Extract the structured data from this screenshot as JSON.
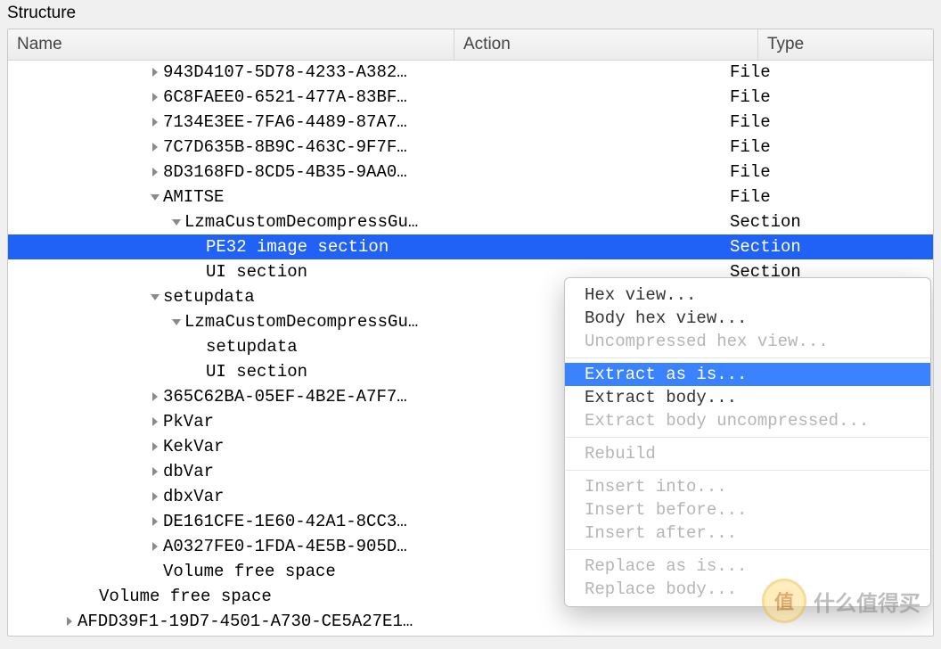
{
  "panel_title": "Structure",
  "columns": {
    "name": "Name",
    "action": "Action",
    "type": "Type"
  },
  "indent_unit": 24,
  "base_indent": 60,
  "rows": [
    {
      "name": "943D4107-5D78-4233-A382…",
      "type": "File",
      "depth": 4,
      "arrow": "right",
      "selected": false
    },
    {
      "name": "6C8FAEE0-6521-477A-83BF…",
      "type": "File",
      "depth": 4,
      "arrow": "right",
      "selected": false
    },
    {
      "name": "7134E3EE-7FA6-4489-87A7…",
      "type": "File",
      "depth": 4,
      "arrow": "right",
      "selected": false
    },
    {
      "name": "7C7D635B-8B9C-463C-9F7F…",
      "type": "File",
      "depth": 4,
      "arrow": "right",
      "selected": false
    },
    {
      "name": "8D3168FD-8CD5-4B35-9AA0…",
      "type": "File",
      "depth": 4,
      "arrow": "right",
      "selected": false
    },
    {
      "name": "AMITSE",
      "type": "File",
      "depth": 4,
      "arrow": "down",
      "selected": false
    },
    {
      "name": "LzmaCustomDecompressGu…",
      "type": "Section",
      "depth": 5,
      "arrow": "down",
      "selected": false
    },
    {
      "name": "PE32 image section",
      "type": "Section",
      "depth": 6,
      "arrow": "none",
      "selected": true
    },
    {
      "name": "UI section",
      "type": "Section",
      "depth": 6,
      "arrow": "none",
      "selected": false
    },
    {
      "name": "setupdata",
      "type": "",
      "depth": 4,
      "arrow": "down",
      "selected": false
    },
    {
      "name": "LzmaCustomDecompressGu…",
      "type": "",
      "depth": 5,
      "arrow": "down",
      "selected": false
    },
    {
      "name": "setupdata",
      "type": "",
      "depth": 6,
      "arrow": "none",
      "selected": false
    },
    {
      "name": "UI section",
      "type": "",
      "depth": 6,
      "arrow": "none",
      "selected": false
    },
    {
      "name": "365C62BA-05EF-4B2E-A7F7…",
      "type": "",
      "depth": 4,
      "arrow": "right",
      "selected": false
    },
    {
      "name": "PkVar",
      "type": "",
      "depth": 4,
      "arrow": "right",
      "selected": false
    },
    {
      "name": "KekVar",
      "type": "",
      "depth": 4,
      "arrow": "right",
      "selected": false
    },
    {
      "name": "dbVar",
      "type": "",
      "depth": 4,
      "arrow": "right",
      "selected": false
    },
    {
      "name": "dbxVar",
      "type": "",
      "depth": 4,
      "arrow": "right",
      "selected": false
    },
    {
      "name": "DE161CFE-1E60-42A1-8CC3…",
      "type": "",
      "depth": 4,
      "arrow": "right",
      "selected": false
    },
    {
      "name": "A0327FE0-1FDA-4E5B-905D…",
      "type": "",
      "depth": 4,
      "arrow": "right",
      "selected": false
    },
    {
      "name": "Volume free space",
      "type": "",
      "depth": 4,
      "arrow": "none",
      "selected": false
    },
    {
      "name": "Volume free space",
      "type": "",
      "depth": 1,
      "arrow": "none",
      "selected": false
    },
    {
      "name": "AFDD39F1-19D7-4501-A730-CE5A27E1…",
      "type": "",
      "depth": 0,
      "arrow": "right",
      "selected": false
    }
  ],
  "context_menu": {
    "groups": [
      [
        {
          "label": "Hex view...",
          "enabled": true,
          "hover": false
        },
        {
          "label": "Body hex view...",
          "enabled": true,
          "hover": false
        },
        {
          "label": "Uncompressed hex view...",
          "enabled": false,
          "hover": false
        }
      ],
      [
        {
          "label": "Extract as is...",
          "enabled": true,
          "hover": true
        },
        {
          "label": "Extract body...",
          "enabled": true,
          "hover": false
        },
        {
          "label": "Extract body uncompressed...",
          "enabled": false,
          "hover": false
        }
      ],
      [
        {
          "label": "Rebuild",
          "enabled": false,
          "hover": false
        }
      ],
      [
        {
          "label": "Insert into...",
          "enabled": false,
          "hover": false
        },
        {
          "label": "Insert before...",
          "enabled": false,
          "hover": false
        },
        {
          "label": "Insert after...",
          "enabled": false,
          "hover": false
        }
      ],
      [
        {
          "label": "Replace as is...",
          "enabled": false,
          "hover": false
        },
        {
          "label": "Replace body...",
          "enabled": false,
          "hover": false
        }
      ]
    ]
  },
  "watermark": {
    "badge": "值",
    "text": "什么值得买"
  }
}
